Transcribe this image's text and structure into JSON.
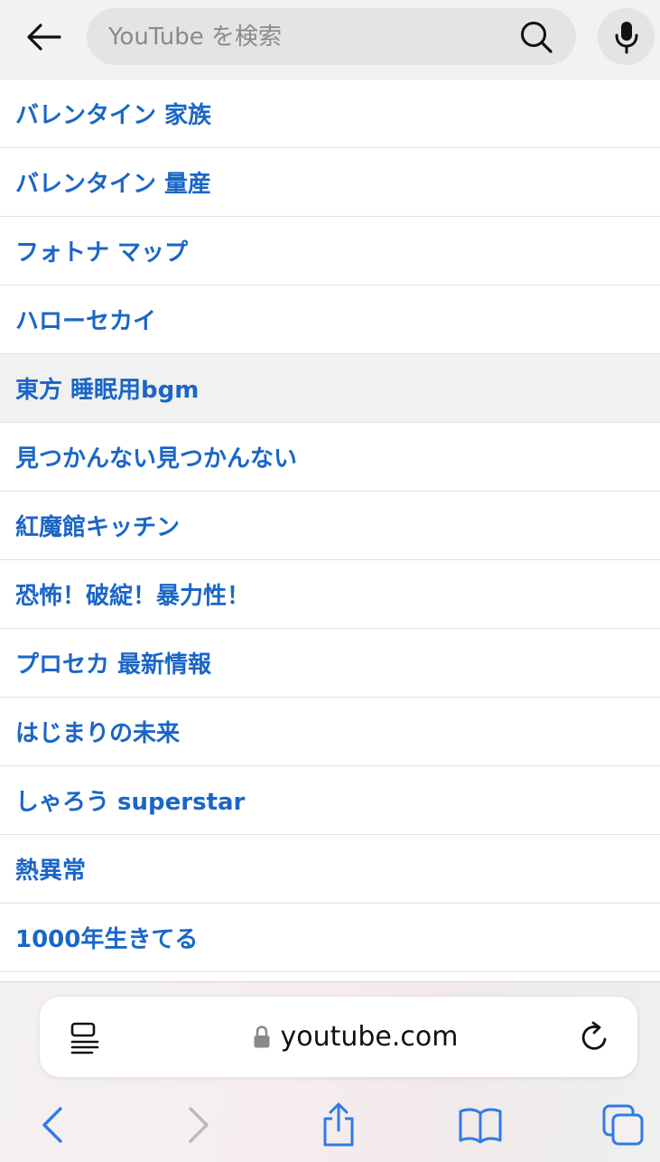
{
  "search": {
    "placeholder": "YouTube を検索",
    "value": ""
  },
  "suggestions": [
    {
      "label": "バレンタイン 家族",
      "highlighted": false
    },
    {
      "label": "バレンタイン 量産",
      "highlighted": false
    },
    {
      "label": "フォトナ マップ",
      "highlighted": false
    },
    {
      "label": "ハローセカイ",
      "highlighted": false
    },
    {
      "label": "東方 睡眠用bgm",
      "highlighted": true
    },
    {
      "label": "見つかんない見つかんない",
      "highlighted": false
    },
    {
      "label": "紅魔館キッチン",
      "highlighted": false
    },
    {
      "label": "恐怖！破綻！暴力性！",
      "highlighted": false
    },
    {
      "label": "プロセカ 最新情報",
      "highlighted": false
    },
    {
      "label": "はじまりの未来",
      "highlighted": false
    },
    {
      "label": "しゃろう superstar",
      "highlighted": false
    },
    {
      "label": "熱異常",
      "highlighted": false
    },
    {
      "label": "1000年生きてる",
      "highlighted": false
    }
  ],
  "browser": {
    "url": "youtube.com"
  },
  "icons": {
    "back": "back-arrow-icon",
    "search": "search-icon",
    "mic": "microphone-icon",
    "reader": "reader-view-icon",
    "lock": "lock-icon",
    "reload": "reload-icon",
    "nav_back": "chevron-left-icon",
    "nav_forward": "chevron-right-icon",
    "share": "share-icon",
    "bookmarks": "book-icon",
    "tabs": "tabs-icon"
  },
  "colors": {
    "link": "#1a66c7",
    "toolbar_accent": "#2f7be6",
    "toolbar_disabled": "#b9b9b9"
  }
}
